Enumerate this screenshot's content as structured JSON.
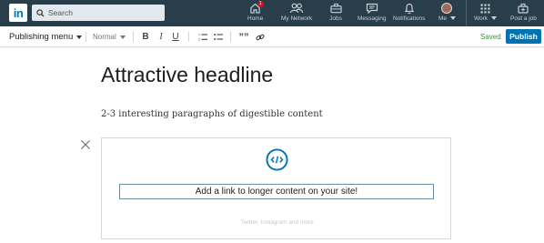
{
  "nav": {
    "logo_text": "in",
    "search_placeholder": "Search",
    "items": [
      {
        "label": "Home",
        "icon": "home-icon",
        "badge": "1"
      },
      {
        "label": "My Network",
        "icon": "my-network-icon"
      },
      {
        "label": "Jobs",
        "icon": "jobs-icon"
      },
      {
        "label": "Messaging",
        "icon": "messaging-icon"
      },
      {
        "label": "Notifications",
        "icon": "notifications-icon"
      },
      {
        "label": "Me",
        "icon": "avatar"
      },
      {
        "label": "Work",
        "icon": "grid-icon"
      },
      {
        "label": "Post a job",
        "icon": "post-job-icon"
      }
    ],
    "colors": {
      "bar": "#283e4a",
      "brand": "#0073b1"
    }
  },
  "toolbar": {
    "publishing_menu": "Publishing menu",
    "style_select": "Normal",
    "bold": "B",
    "italic": "I",
    "underline": "U",
    "quote": "””",
    "status": "Saved",
    "publish": "Publish"
  },
  "content": {
    "headline": "Attractive headline",
    "subtext": "2-3 interesting paragraphs of digestible content",
    "embed": {
      "link_placeholder": "Add a link to longer content on your site!",
      "hint": "Twitter, Instagram and more"
    }
  }
}
